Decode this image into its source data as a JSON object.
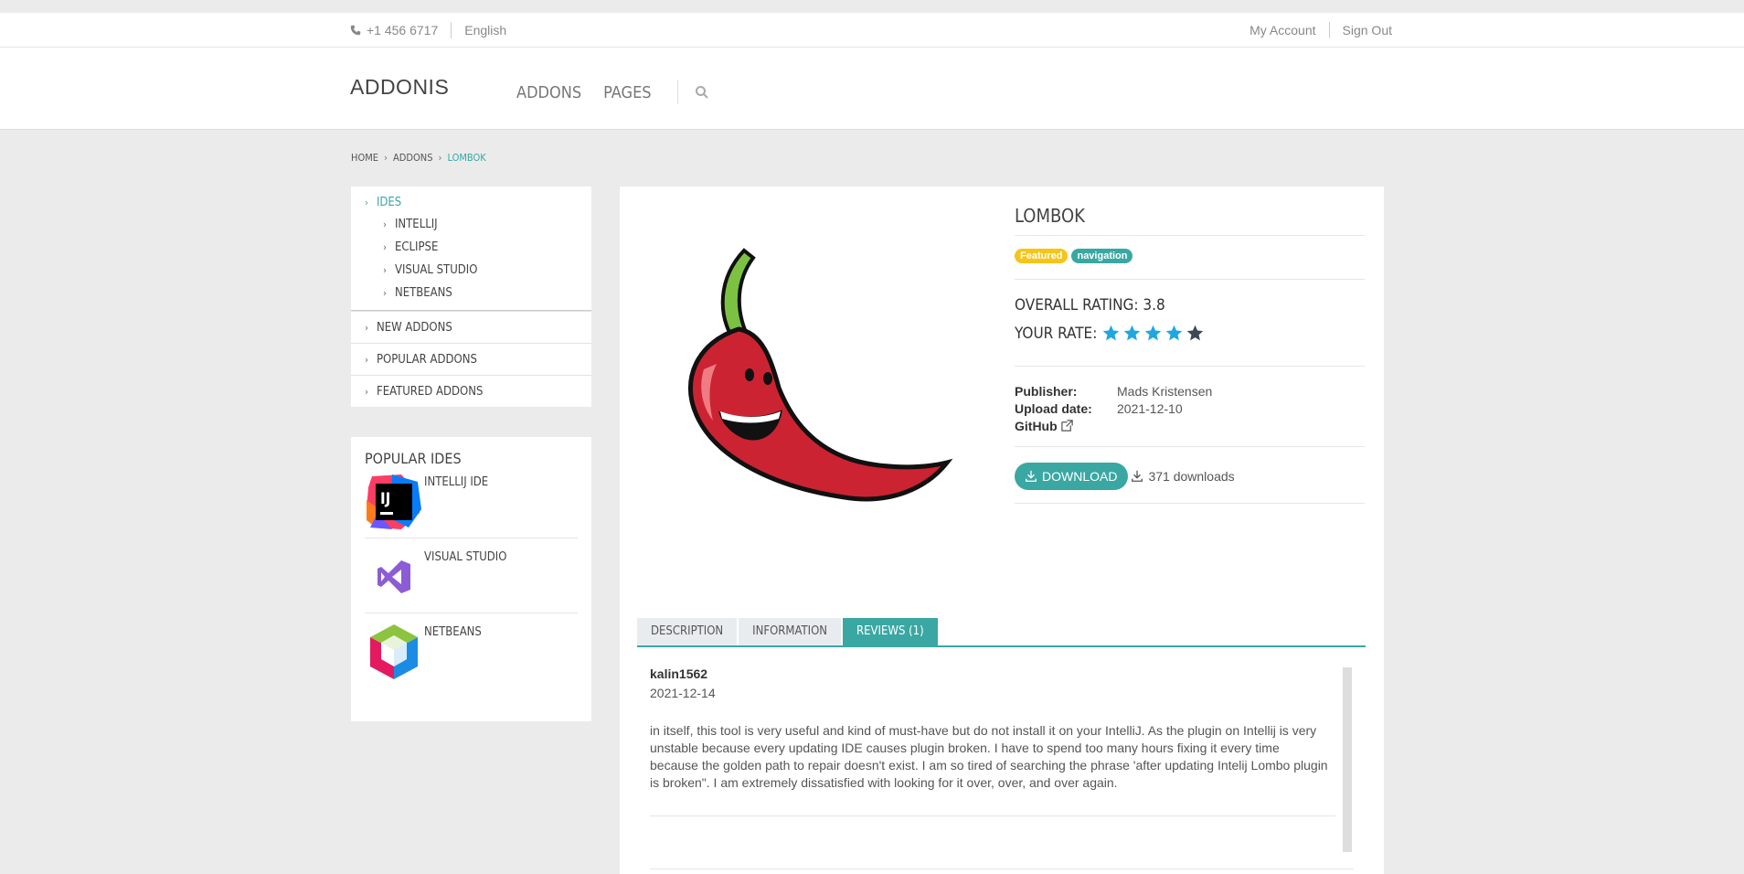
{
  "topbar": {
    "phone": "+1 456 6717",
    "language": "English",
    "my_account": "My Account",
    "sign_out": "Sign Out"
  },
  "header": {
    "logo": "ADDONIS",
    "nav": [
      "ADDONS",
      "PAGES"
    ]
  },
  "breadcrumb": [
    "HOME",
    "ADDONS",
    "LOMBOK"
  ],
  "sidebar": {
    "top": "IDES",
    "sub": [
      "INTELLIJ",
      "ECLIPSE",
      "VISUAL STUDIO",
      "NETBEANS"
    ],
    "main": [
      "NEW ADDONS",
      "POPULAR ADDONS",
      "FEATURED ADDONS"
    ]
  },
  "popular": {
    "title": "POPULAR IDES",
    "items": [
      "INTELLIJ IDE",
      "VISUAL STUDIO",
      "NETBEANS"
    ]
  },
  "product": {
    "title": "LOMBOK",
    "tags": [
      "Featured",
      "navigation"
    ],
    "overall_rating": "OVERALL RATING: 3.8",
    "your_rate_label": "YOUR RATE:",
    "your_rate_value": 4,
    "your_rate_max": 5,
    "publisher_label": "Publisher:",
    "publisher": "Mads Kristensen",
    "upload_label": "Upload date:",
    "upload_date": "2021-12-10",
    "github_label": "GitHub",
    "download_label": "DOWNLOAD",
    "downloads": "371 downloads"
  },
  "tabs": [
    "DESCRIPTION",
    "INFORMATION",
    "REVIEWS (1)"
  ],
  "review": {
    "user": "kalin1562",
    "date": "2021-12-14",
    "text": "in itself, this tool is very useful and kind of must-have but do not install it on your IntelliJ. As the plugin on Intellij is very unstable because every updating IDE causes plugin broken. I have to spend too many hours fixing it every time because the golden path to repair doesn't exist. I am so tired of searching the phrase 'after updating Intelij Lombo plugin is broken\". I am extremely dissatisfied with looking for it over, over, and over again."
  },
  "colors": {
    "accent": "#3aa7a3",
    "featured": "#f5c518",
    "star_on": "#1ea7e1",
    "star_off": "#3e4756"
  }
}
